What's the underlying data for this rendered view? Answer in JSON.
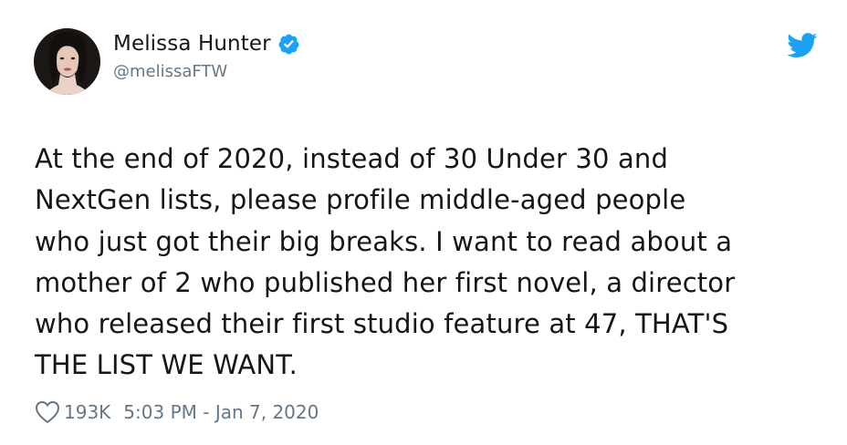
{
  "tweet": {
    "author": {
      "display_name": "Melissa Hunter",
      "handle": "@melissaFTW",
      "verified": true,
      "avatar_icon": "profile-photo"
    },
    "text_lines": [
      "At the end of 2020, instead of 30 Under 30 and",
      "NextGen lists, please profile middle-aged people",
      "who just got their big breaks. I want to read about a",
      "mother of 2 who published her first novel, a director",
      "who released their first studio feature at 47, THAT'S",
      "THE LIST WE WANT."
    ],
    "likes": "193K",
    "timestamp": "5:03 PM - Jan 7, 2020"
  },
  "icons": {
    "verified": "verified-badge-icon",
    "brand": "twitter-bird-icon",
    "like": "heart-outline-icon"
  },
  "colors": {
    "twitter_blue": "#1da1f2",
    "text_primary": "#14171a",
    "text_secondary": "#657786",
    "background": "#ffffff"
  }
}
